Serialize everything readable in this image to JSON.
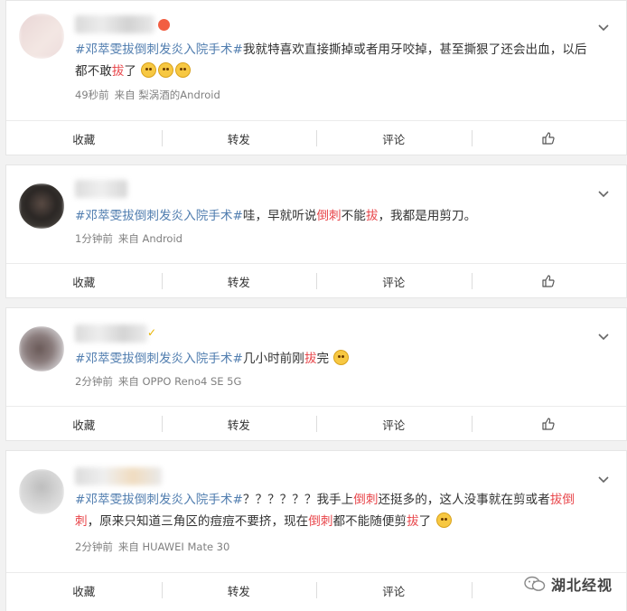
{
  "posts": [
    {
      "hashtag": "#邓萃雯拔倒刺发炎入院手术#",
      "segments": [
        {
          "t": "我就特喜欢直接撕掉或者用牙咬掉，甚至撕狠了还会出血，以后都不敢",
          "c": ""
        },
        {
          "t": "拔",
          "c": "hl"
        },
        {
          "t": "了",
          "c": ""
        }
      ],
      "emoji_count": 3,
      "time": "49秒前",
      "source": "来自 梨涡酒的Android",
      "actions": {
        "collect": "收藏",
        "repost": "转发",
        "comment": "评论"
      }
    },
    {
      "hashtag": "#邓萃雯拔倒刺发炎入院手术#",
      "segments": [
        {
          "t": "哇，早就听说",
          "c": ""
        },
        {
          "t": "倒刺",
          "c": "hl"
        },
        {
          "t": "不能",
          "c": ""
        },
        {
          "t": "拔",
          "c": "hl"
        },
        {
          "t": "，我都是用剪刀。",
          "c": ""
        }
      ],
      "time": "1分钟前",
      "source": "来自 Android",
      "actions": {
        "collect": "收藏",
        "repost": "转发",
        "comment": "评论"
      }
    },
    {
      "hashtag": "#邓萃雯拔倒刺发炎入院手术#",
      "segments": [
        {
          "t": "几小时前刚",
          "c": ""
        },
        {
          "t": "拔",
          "c": "hl"
        },
        {
          "t": "完",
          "c": ""
        }
      ],
      "time": "2分钟前",
      "source": "来自 OPPO Reno4 SE 5G",
      "actions": {
        "collect": "收藏",
        "repost": "转发",
        "comment": "评论"
      }
    },
    {
      "hashtag": "#邓萃雯拔倒刺发炎入院手术#",
      "segments": [
        {
          "t": "？？？？？？我手上",
          "c": ""
        },
        {
          "t": "倒刺",
          "c": "hl"
        },
        {
          "t": "还挺多的，这人没事就在剪或者",
          "c": ""
        },
        {
          "t": "拔倒刺",
          "c": "hl"
        },
        {
          "t": "，原来只知道三角区的痘痘不要挤，现在",
          "c": ""
        },
        {
          "t": "倒刺",
          "c": "hl"
        },
        {
          "t": "都不能随便剪",
          "c": ""
        },
        {
          "t": "拔",
          "c": "hl"
        },
        {
          "t": "了",
          "c": ""
        }
      ],
      "time": "2分钟前",
      "source": "来自 HUAWEI Mate 30",
      "actions": {
        "collect": "收藏",
        "repost": "转发",
        "comment": "评论"
      }
    }
  ],
  "watermark": "湖北经视",
  "colors": {
    "hashtag": "#507daf",
    "highlight": "#e8454a",
    "meta": "#808080"
  }
}
